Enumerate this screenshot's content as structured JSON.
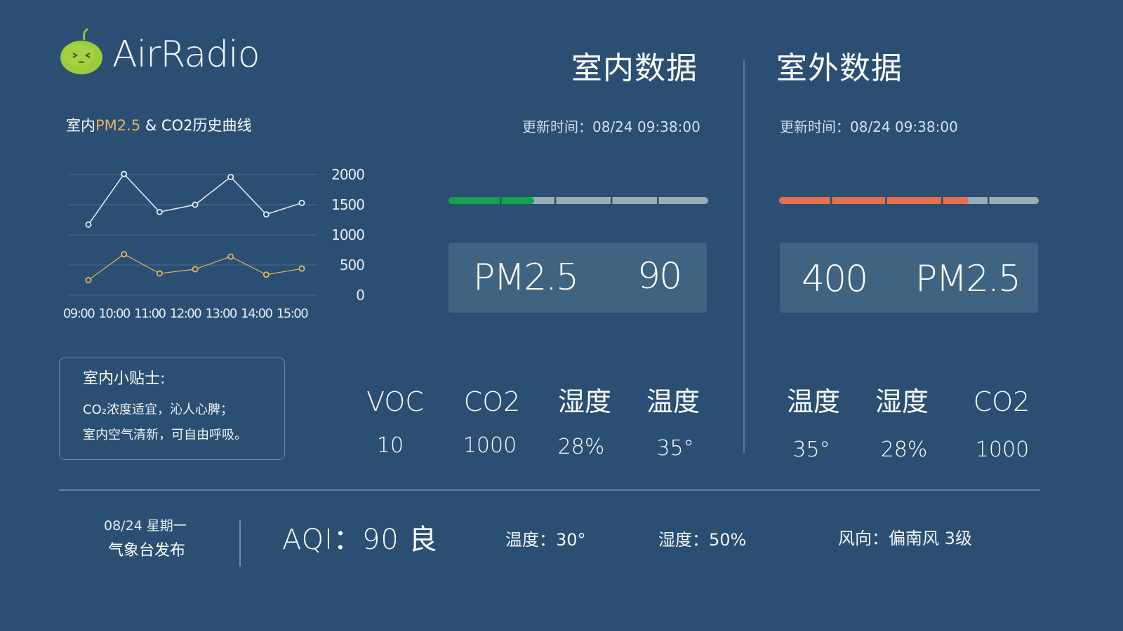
{
  "logo": {
    "name": "AirRadio"
  },
  "chart": {
    "title_prefix": "室内",
    "title_accent": "PM2.5",
    "title_suffix": " & CO2历史曲线"
  },
  "chart_data": {
    "type": "line",
    "x": [
      "09:00",
      "10:00",
      "11:00",
      "12:00",
      "13:00",
      "14:00",
      "15:00"
    ],
    "yticks": [
      "2000",
      "1500",
      "1000",
      "500",
      "0"
    ],
    "ylim": [
      0,
      2000
    ],
    "grid": true,
    "series": [
      {
        "values": [
          1170,
          2010,
          1380,
          1500,
          1960,
          1340,
          1530
        ],
        "color": "#e8eef4"
      },
      {
        "values": [
          250,
          680,
          360,
          430,
          640,
          340,
          440
        ],
        "color": "#e4b35f"
      }
    ]
  },
  "tips": {
    "title": "室内小贴士:",
    "line1": "CO₂浓度适宜，沁人心脾；",
    "line2": "室内空气清新，可自由呼吸。"
  },
  "indoor": {
    "title": "室内数据",
    "update_time": "更新时间：08/24  09:38:00",
    "bar": {
      "level": 0.33,
      "color": "#16a050",
      "track_color": "#9aabb9"
    },
    "card_left": "PM2.5",
    "card_right": "90",
    "metrics": [
      {
        "label": "VOC",
        "value": "10"
      },
      {
        "label": "CO2",
        "value": "1000"
      },
      {
        "label": "湿度",
        "value": "28%"
      },
      {
        "label": "温度",
        "value": "35°"
      }
    ]
  },
  "outdoor": {
    "title": "室外数据",
    "update_time": "更新时间：08/24  09:38:00",
    "bar": {
      "level": 0.73,
      "color": "#e46f4e",
      "track_color": "#9aabb9"
    },
    "card_left": "400",
    "card_right": "PM2.5",
    "metrics": [
      {
        "label": "温度",
        "value": "35°"
      },
      {
        "label": "湿度",
        "value": "28%"
      },
      {
        "label": "CO2",
        "value": "1000"
      }
    ]
  },
  "bottom": {
    "date": "08/24   星期一",
    "source": "气象台发布",
    "aqi": "AQI：90  良",
    "temperature": "温度：30°",
    "humidity": "湿度：50%",
    "wind": "风向：偏南风  3级"
  }
}
